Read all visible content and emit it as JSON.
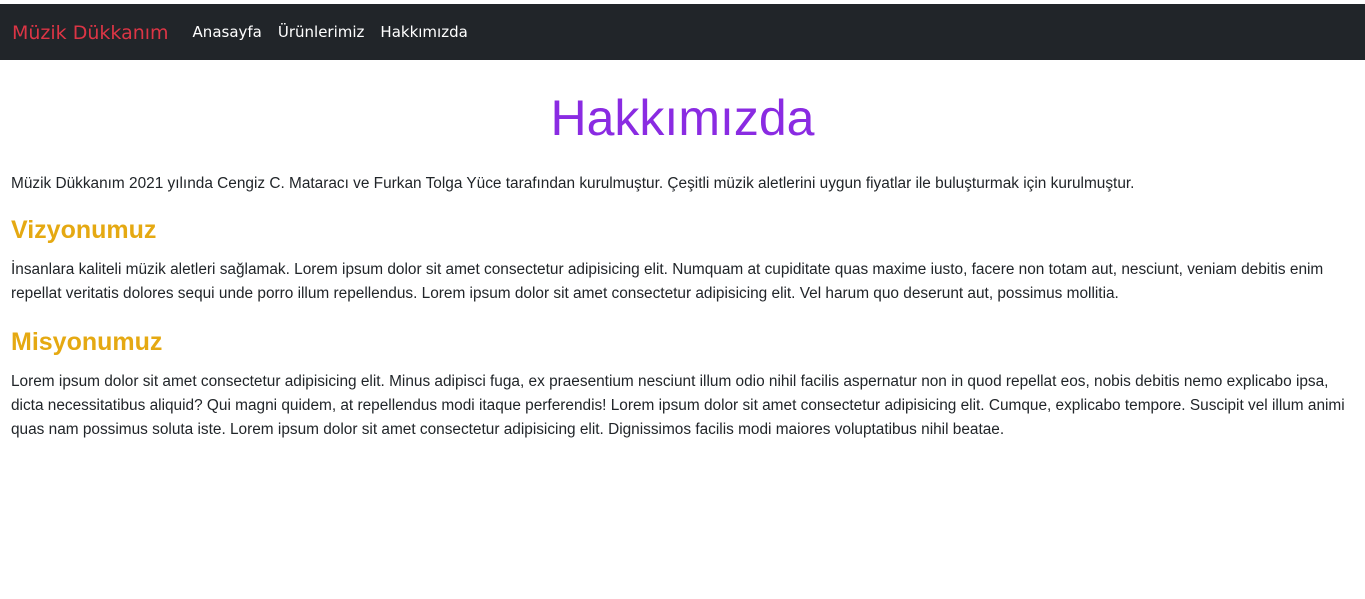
{
  "navbar": {
    "brand": "Müzik Dükkanım",
    "links": [
      "Anasayfa",
      "Ürünlerimiz",
      "Hakkımızda"
    ]
  },
  "main": {
    "title": "Hakkımızda",
    "intro": "Müzik Dükkanım 2021 yılında Cengiz C. Mataracı ve Furkan Tolga Yüce tarafından kurulmuştur. Çeşitli müzik aletlerini uygun fiyatlar ile buluşturmak için kurulmuştur.",
    "vision": {
      "heading": "Vizyonumuz",
      "text": "İnsanlara kaliteli müzik aletleri sağlamak. Lorem ipsum dolor sit amet consectetur adipisicing elit. Numquam at cupiditate quas maxime iusto, facere non totam aut, nesciunt, veniam debitis enim repellat veritatis dolores sequi unde porro illum repellendus. Lorem ipsum dolor sit amet consectetur adipisicing elit. Vel harum quo deserunt aut, possimus mollitia."
    },
    "mission": {
      "heading": "Misyonumuz",
      "text": "Lorem ipsum dolor sit amet consectetur adipisicing elit. Minus adipisci fuga, ex praesentium nesciunt illum odio nihil facilis aspernatur non in quod repellat eos, nobis debitis nemo explicabo ipsa, dicta necessitatibus aliquid? Qui magni quidem, at repellendus modi itaque perferendis! Lorem ipsum dolor sit amet consectetur adipisicing elit. Cumque, explicabo tempore. Suscipit vel illum animi quas nam possimus soluta iste. Lorem ipsum dolor sit amet consectetur adipisicing elit. Dignissimos facilis modi maiores voluptatibus nihil beatae."
    }
  },
  "colors": {
    "navbar_bg": "#212529",
    "brand": "#dc3545",
    "title": "#8a2be2",
    "section_heading": "#e5a912"
  }
}
